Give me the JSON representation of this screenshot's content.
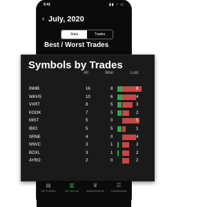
{
  "header": {
    "month": "July, 2020",
    "tabs": [
      {
        "label": "Stats"
      },
      {
        "label": "Trades"
      }
    ]
  },
  "section": {
    "title": "Best / Worst Trades"
  },
  "sheet": {
    "title": "Symbols by Trades",
    "columns": {
      "all": "All",
      "won": "Won",
      "lost": "Lost"
    },
    "rows": [
      {
        "symbol": "INMB",
        "all": "16",
        "won": "8",
        "lost": "8"
      },
      {
        "symbol": "WKHS",
        "all": "10",
        "won": "6",
        "lost": "4"
      },
      {
        "symbol": "VXRT",
        "all": "8",
        "won": "5",
        "lost": "3"
      },
      {
        "symbol": "KOOK",
        "all": "7",
        "won": "5",
        "lost": "2"
      },
      {
        "symbol": "MIST",
        "all": "5",
        "won": "0",
        "lost": "5"
      },
      {
        "symbol": "IBIO",
        "all": "5",
        "won": "5",
        "lost": "1"
      },
      {
        "symbol": "SRNE",
        "all": "4",
        "won": "0",
        "lost": "4"
      },
      {
        "symbol": "NNVC",
        "all": "3",
        "won": "1",
        "lost": "2"
      },
      {
        "symbol": "BOXL",
        "all": "3",
        "won": "1",
        "lost": "2"
      },
      {
        "symbol": "AYRO",
        "all": "2",
        "won": "0",
        "lost": "2"
      }
    ]
  },
  "tabbar": {
    "items": [
      {
        "label": "My Portfolio",
        "icon": "portfolio-icon"
      },
      {
        "label": "My Journal",
        "icon": "journal-icon"
      },
      {
        "label": "Achievements",
        "icon": "trophy-icon"
      },
      {
        "label": "Leaderboard",
        "icon": "leaderboard-icon"
      }
    ]
  },
  "colors": {
    "won": "#2ea84d",
    "lost": "#c84646",
    "background": "#0b0b0b"
  }
}
